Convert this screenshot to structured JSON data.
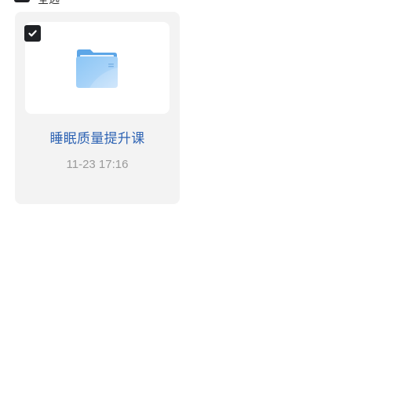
{
  "select_all": {
    "checked": true,
    "label": "全选"
  },
  "files": [
    {
      "type": "folder",
      "icon": "folder-icon",
      "name": "睡眠质量提升课",
      "modified": "11-23 17:16",
      "selected": true
    }
  ],
  "colors": {
    "checkbox": "#1f2125",
    "card_bg": "#f3f3f3",
    "file_name": "#2f64b4",
    "timestamp": "#9a9a9a",
    "folder": "#6fb2ee"
  }
}
